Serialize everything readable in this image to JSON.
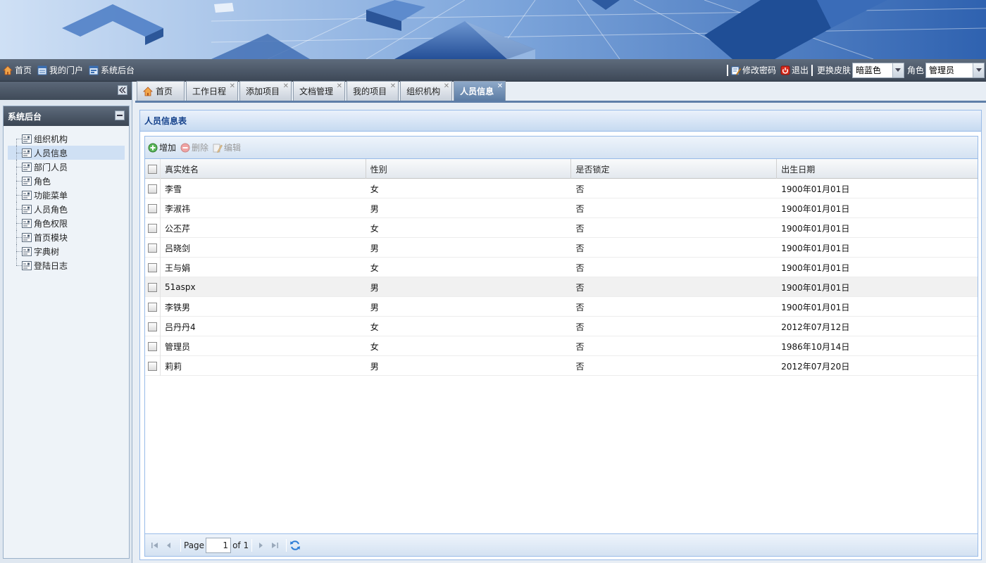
{
  "topnav": {
    "left_links": [
      {
        "label": "首页",
        "icon": "home-icon"
      },
      {
        "label": "我的门户",
        "icon": "portal-icon"
      },
      {
        "label": "系统后台",
        "icon": "admin-icon"
      }
    ],
    "change_password": "修改密码",
    "logout": "退出",
    "skin_label": "更换皮肤",
    "skin_value": "暗蓝色",
    "role_label": "角色",
    "role_value": "管理员"
  },
  "sidebar": {
    "title": "系统后台",
    "items": [
      {
        "label": "组织机构"
      },
      {
        "label": "人员信息",
        "selected": true
      },
      {
        "label": "部门人员"
      },
      {
        "label": "角色"
      },
      {
        "label": "功能菜单"
      },
      {
        "label": "人员角色"
      },
      {
        "label": "角色权限"
      },
      {
        "label": "首页模块"
      },
      {
        "label": "字典树"
      },
      {
        "label": "登陆日志"
      }
    ]
  },
  "tabs": [
    {
      "label": "首页",
      "closable": false,
      "active": false
    },
    {
      "label": "工作日程",
      "closable": true,
      "active": false
    },
    {
      "label": "添加项目",
      "closable": true,
      "active": false
    },
    {
      "label": "文档管理",
      "closable": true,
      "active": false
    },
    {
      "label": "我的项目",
      "closable": true,
      "active": false
    },
    {
      "label": "组织机构",
      "closable": true,
      "active": false
    },
    {
      "label": "人员信息",
      "closable": true,
      "active": true
    }
  ],
  "panel": {
    "title": "人员信息表"
  },
  "toolbar": {
    "add_label": "增加",
    "delete_label": "删除",
    "edit_label": "编辑"
  },
  "grid": {
    "columns": [
      "真实姓名",
      "性别",
      "是否锁定",
      "出生日期"
    ],
    "rows": [
      [
        "李雪",
        "女",
        "否",
        "1900年01月01日"
      ],
      [
        "李淑祎",
        "男",
        "否",
        "1900年01月01日"
      ],
      [
        "公丕芹",
        "女",
        "否",
        "1900年01月01日"
      ],
      [
        "吕晓剑",
        "男",
        "否",
        "1900年01月01日"
      ],
      [
        "王与娟",
        "女",
        "否",
        "1900年01月01日"
      ],
      [
        "51aspx",
        "男",
        "否",
        "1900年01月01日"
      ],
      [
        "李铁男",
        "男",
        "否",
        "1900年01月01日"
      ],
      [
        "吕丹丹4",
        "女",
        "否",
        "2012年07月12日"
      ],
      [
        "管理员",
        "女",
        "否",
        "1986年10月14日"
      ],
      [
        "莉莉",
        "男",
        "否",
        "2012年07月20日"
      ]
    ]
  },
  "pager": {
    "page_label": "Page",
    "page_value": "1",
    "of_label": "of 1"
  },
  "colors": {
    "accent": "#5e7ea8",
    "header_text": "#15428b"
  }
}
